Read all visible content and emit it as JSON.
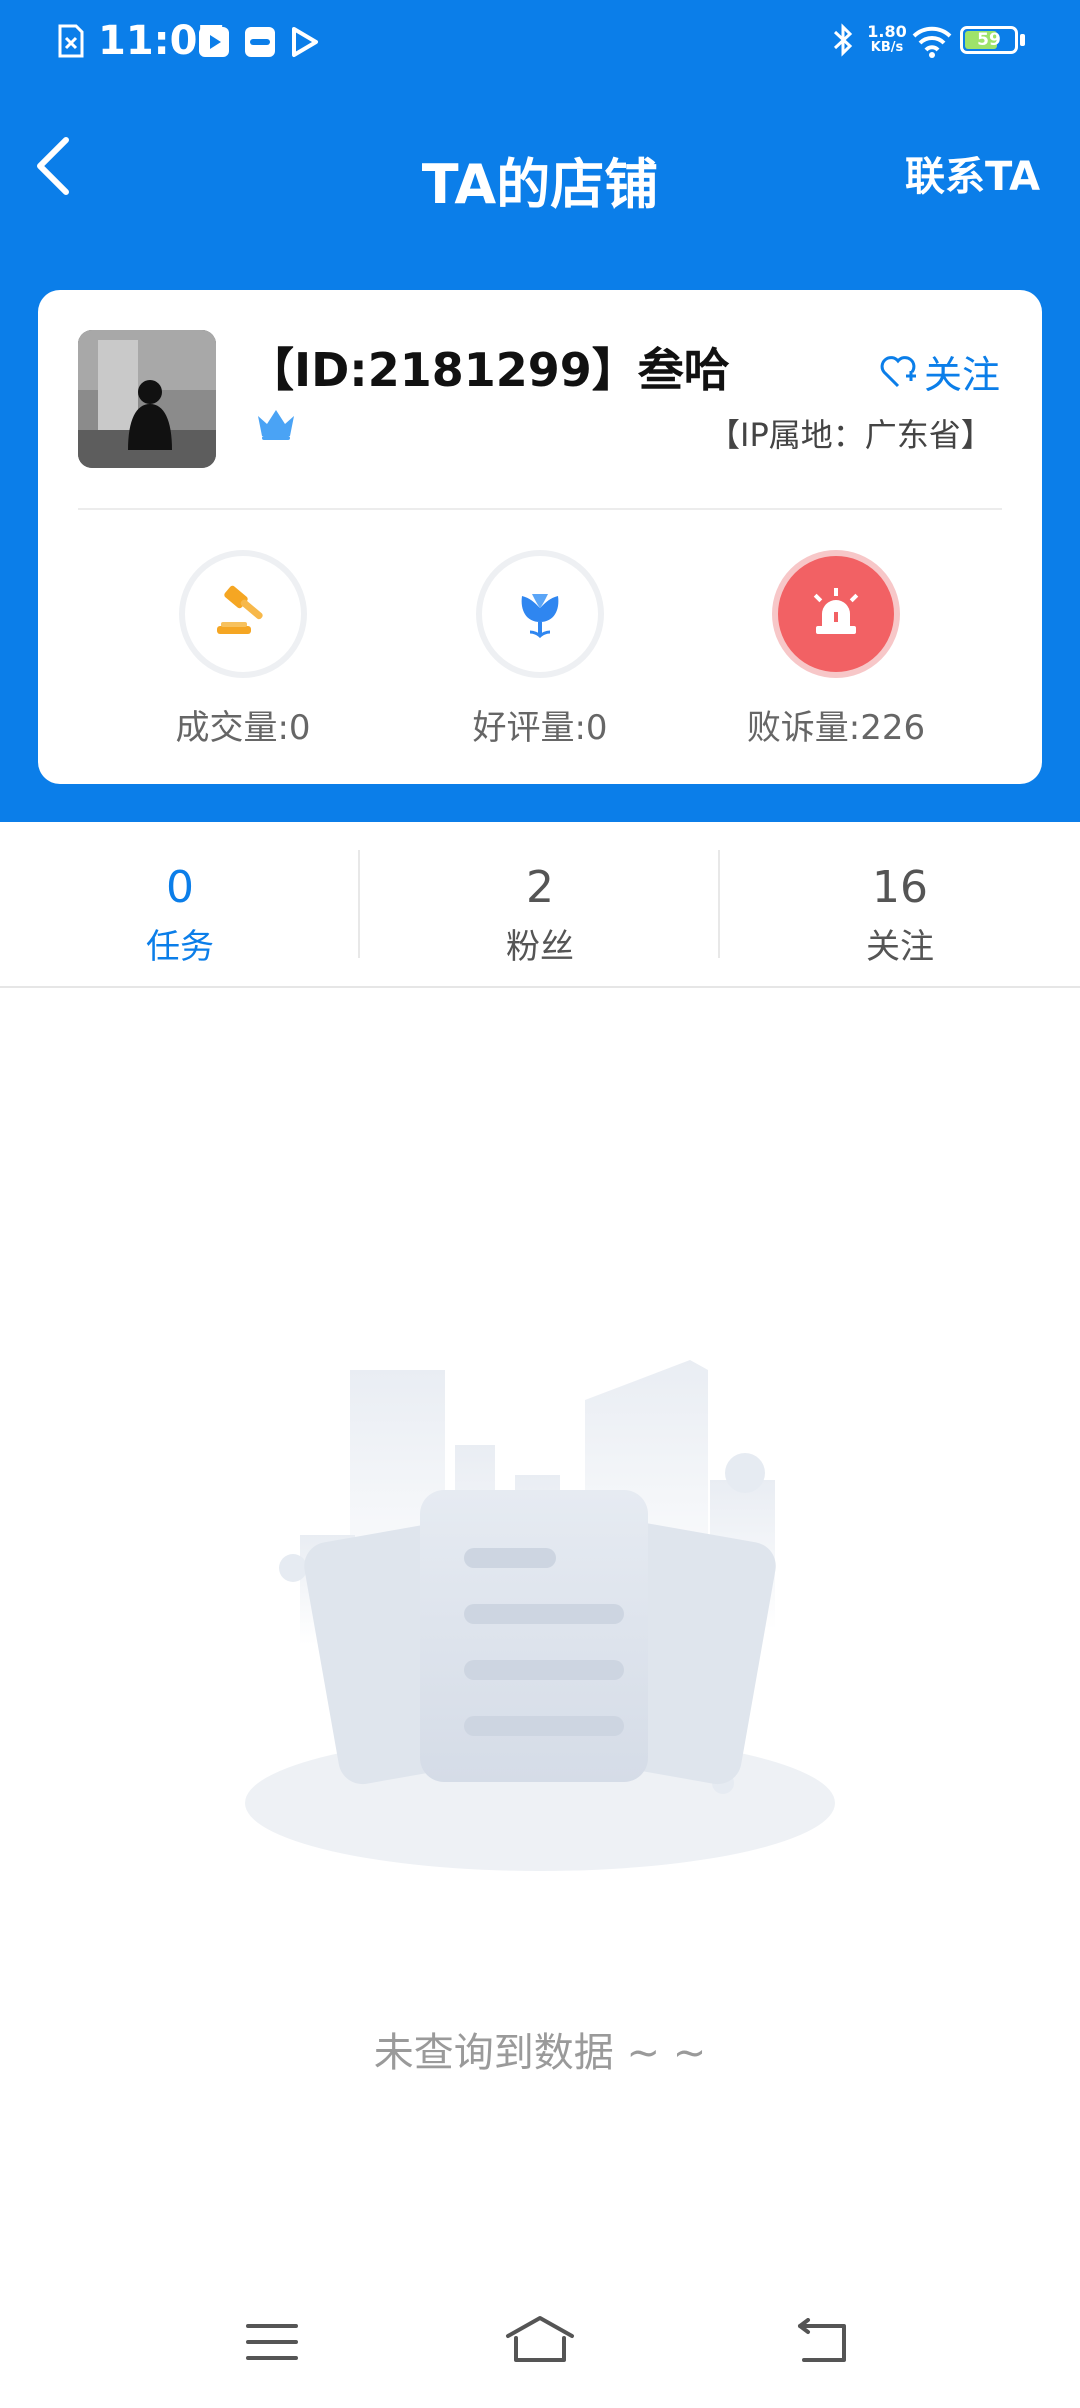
{
  "status_bar": {
    "time": "11:07",
    "net_speed_value": "1.80",
    "net_speed_unit": "KB/s",
    "battery": "59"
  },
  "nav": {
    "title": "TA的店铺",
    "contact_label": "联系TA"
  },
  "profile": {
    "name": "【ID:2181299】叁哈",
    "follow_label": "关注",
    "ip_location": "【IP属地：广东省】"
  },
  "stats": [
    {
      "label": "成交量:0",
      "icon": "gavel-icon",
      "color": "#f5a623"
    },
    {
      "label": "好评量:0",
      "icon": "tulip-icon",
      "color": "#2f86f0"
    },
    {
      "label": "败诉量:226",
      "icon": "alarm-icon",
      "color": "#f26164"
    }
  ],
  "tabs": [
    {
      "count": "0",
      "label": "任务",
      "active": true
    },
    {
      "count": "2",
      "label": "粉丝",
      "active": false
    },
    {
      "count": "16",
      "label": "关注",
      "active": false
    }
  ],
  "empty": {
    "message": "未查询到数据 ~ ~"
  },
  "colors": {
    "primary": "#0b7ee9",
    "alarm": "#f26164",
    "gavel": "#f5a623"
  }
}
